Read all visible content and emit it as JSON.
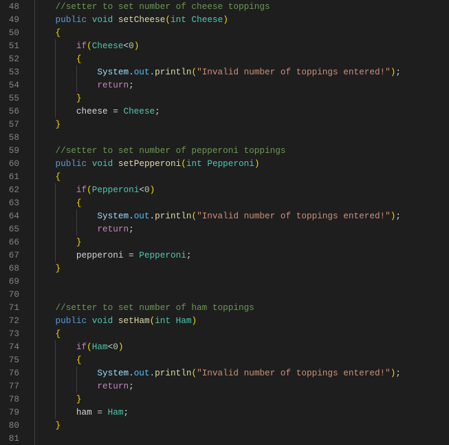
{
  "editor": {
    "lines": [
      {
        "num": "48",
        "tokens": [
          [
            "x",
            "    "
          ],
          [
            "c",
            "//setter to set number of cheese toppings"
          ]
        ]
      },
      {
        "num": "49",
        "tokens": [
          [
            "x",
            "    "
          ],
          [
            "k",
            "public"
          ],
          [
            "x",
            " "
          ],
          [
            "t",
            "void"
          ],
          [
            "x",
            " "
          ],
          [
            "f",
            "setCheese"
          ],
          [
            "b",
            "("
          ],
          [
            "ty",
            "int"
          ],
          [
            "x",
            " "
          ],
          [
            "cv",
            "Cheese"
          ],
          [
            "b",
            ")"
          ]
        ]
      },
      {
        "num": "50",
        "tokens": [
          [
            "x",
            "    "
          ],
          [
            "b",
            "{"
          ]
        ]
      },
      {
        "num": "51",
        "tokens": [
          [
            "x",
            "        "
          ],
          [
            "r",
            "if"
          ],
          [
            "b",
            "("
          ],
          [
            "cv",
            "Cheese"
          ],
          [
            "x",
            "<"
          ],
          [
            "n",
            "0"
          ],
          [
            "b",
            ")"
          ]
        ]
      },
      {
        "num": "52",
        "tokens": [
          [
            "x",
            "        "
          ],
          [
            "b",
            "{"
          ]
        ]
      },
      {
        "num": "53",
        "tokens": [
          [
            "x",
            "            "
          ],
          [
            "v",
            "System"
          ],
          [
            "x",
            "."
          ],
          [
            "o",
            "out"
          ],
          [
            "x",
            "."
          ],
          [
            "f",
            "println"
          ],
          [
            "b",
            "("
          ],
          [
            "s",
            "\"Invalid number of toppings entered!\""
          ],
          [
            "b",
            ")"
          ],
          [
            "x",
            ";"
          ]
        ]
      },
      {
        "num": "54",
        "tokens": [
          [
            "x",
            "            "
          ],
          [
            "r",
            "return"
          ],
          [
            "x",
            ";"
          ]
        ]
      },
      {
        "num": "55",
        "tokens": [
          [
            "x",
            "        "
          ],
          [
            "b",
            "}"
          ]
        ]
      },
      {
        "num": "56",
        "tokens": [
          [
            "x",
            "        "
          ],
          [
            "x",
            "cheese = "
          ],
          [
            "cv",
            "Cheese"
          ],
          [
            "x",
            ";"
          ]
        ]
      },
      {
        "num": "57",
        "tokens": [
          [
            "x",
            "    "
          ],
          [
            "b",
            "}"
          ]
        ]
      },
      {
        "num": "58",
        "tokens": []
      },
      {
        "num": "59",
        "tokens": [
          [
            "x",
            "    "
          ],
          [
            "c",
            "//setter to set number of pepperoni toppings"
          ]
        ]
      },
      {
        "num": "60",
        "tokens": [
          [
            "x",
            "    "
          ],
          [
            "k",
            "public"
          ],
          [
            "x",
            " "
          ],
          [
            "t",
            "void"
          ],
          [
            "x",
            " "
          ],
          [
            "f",
            "setPepperoni"
          ],
          [
            "b",
            "("
          ],
          [
            "ty",
            "int"
          ],
          [
            "x",
            " "
          ],
          [
            "cv",
            "Pepperoni"
          ],
          [
            "b",
            ")"
          ]
        ]
      },
      {
        "num": "61",
        "tokens": [
          [
            "x",
            "    "
          ],
          [
            "b",
            "{"
          ]
        ]
      },
      {
        "num": "62",
        "tokens": [
          [
            "x",
            "        "
          ],
          [
            "r",
            "if"
          ],
          [
            "b",
            "("
          ],
          [
            "cv",
            "Pepperoni"
          ],
          [
            "x",
            "<"
          ],
          [
            "n",
            "0"
          ],
          [
            "b",
            ")"
          ]
        ]
      },
      {
        "num": "63",
        "tokens": [
          [
            "x",
            "        "
          ],
          [
            "b",
            "{"
          ]
        ]
      },
      {
        "num": "64",
        "tokens": [
          [
            "x",
            "            "
          ],
          [
            "v",
            "System"
          ],
          [
            "x",
            "."
          ],
          [
            "o",
            "out"
          ],
          [
            "x",
            "."
          ],
          [
            "f",
            "println"
          ],
          [
            "b",
            "("
          ],
          [
            "s",
            "\"Invalid number of toppings entered!\""
          ],
          [
            "b",
            ")"
          ],
          [
            "x",
            ";"
          ]
        ]
      },
      {
        "num": "65",
        "tokens": [
          [
            "x",
            "            "
          ],
          [
            "r",
            "return"
          ],
          [
            "x",
            ";"
          ]
        ]
      },
      {
        "num": "66",
        "tokens": [
          [
            "x",
            "        "
          ],
          [
            "b",
            "}"
          ]
        ]
      },
      {
        "num": "67",
        "tokens": [
          [
            "x",
            "        "
          ],
          [
            "x",
            "pepperoni = "
          ],
          [
            "cv",
            "Pepperoni"
          ],
          [
            "x",
            ";"
          ]
        ]
      },
      {
        "num": "68",
        "tokens": [
          [
            "x",
            "    "
          ],
          [
            "b",
            "}"
          ]
        ]
      },
      {
        "num": "69",
        "tokens": []
      },
      {
        "num": "70",
        "tokens": []
      },
      {
        "num": "71",
        "tokens": [
          [
            "x",
            "    "
          ],
          [
            "c",
            "//setter to set number of ham toppings"
          ]
        ]
      },
      {
        "num": "72",
        "tokens": [
          [
            "x",
            "    "
          ],
          [
            "k",
            "public"
          ],
          [
            "x",
            " "
          ],
          [
            "t",
            "void"
          ],
          [
            "x",
            " "
          ],
          [
            "f",
            "setHam"
          ],
          [
            "b",
            "("
          ],
          [
            "ty",
            "int"
          ],
          [
            "x",
            " "
          ],
          [
            "cv",
            "Ham"
          ],
          [
            "b",
            ")"
          ]
        ]
      },
      {
        "num": "73",
        "tokens": [
          [
            "x",
            "    "
          ],
          [
            "b",
            "{"
          ]
        ]
      },
      {
        "num": "74",
        "tokens": [
          [
            "x",
            "        "
          ],
          [
            "r",
            "if"
          ],
          [
            "b",
            "("
          ],
          [
            "cv",
            "Ham"
          ],
          [
            "x",
            "<"
          ],
          [
            "n",
            "0"
          ],
          [
            "b",
            ")"
          ]
        ]
      },
      {
        "num": "75",
        "tokens": [
          [
            "x",
            "        "
          ],
          [
            "b",
            "{"
          ]
        ]
      },
      {
        "num": "76",
        "tokens": [
          [
            "x",
            "            "
          ],
          [
            "v",
            "System"
          ],
          [
            "x",
            "."
          ],
          [
            "o",
            "out"
          ],
          [
            "x",
            "."
          ],
          [
            "f",
            "println"
          ],
          [
            "b",
            "("
          ],
          [
            "s",
            "\"Invalid number of toppings entered!\""
          ],
          [
            "b",
            ")"
          ],
          [
            "x",
            ";"
          ]
        ]
      },
      {
        "num": "77",
        "tokens": [
          [
            "x",
            "            "
          ],
          [
            "r",
            "return"
          ],
          [
            "x",
            ";"
          ]
        ]
      },
      {
        "num": "78",
        "tokens": [
          [
            "x",
            "        "
          ],
          [
            "b",
            "}"
          ]
        ]
      },
      {
        "num": "79",
        "tokens": [
          [
            "x",
            "        "
          ],
          [
            "x",
            "ham = "
          ],
          [
            "cv",
            "Ham"
          ],
          [
            "x",
            ";"
          ]
        ]
      },
      {
        "num": "80",
        "tokens": [
          [
            "x",
            "    "
          ],
          [
            "b",
            "}"
          ]
        ]
      },
      {
        "num": "81",
        "tokens": []
      }
    ]
  }
}
